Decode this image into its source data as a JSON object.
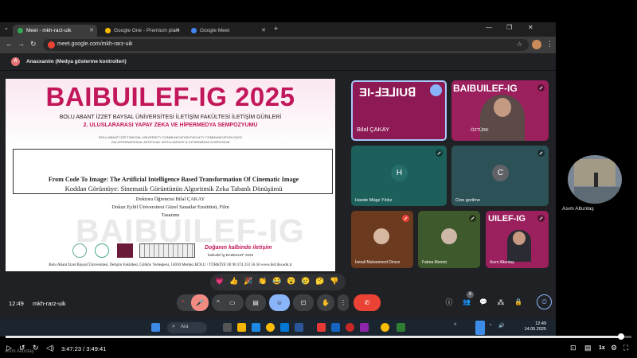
{
  "browser": {
    "tabs": [
      {
        "label": "Meet - mkh-rarz-uik",
        "active": true
      },
      {
        "label": "Google One - Premium planı",
        "active": false
      },
      {
        "label": "Google Meet",
        "active": false
      }
    ],
    "url": "meet.google.com/mkh-rarz-uik"
  },
  "infobar": {
    "avatar_letter": "A",
    "text": "Anasxanim (Medya gösterme kontrolleri)"
  },
  "slide": {
    "title": "BAIBUILEF-IG 2025",
    "subtitle1": "BOLU ABANT İZZET BAYSAL ÜNİVERSİTESİ İLETİŞİM FAKÜLTESİ İLETİŞİM GÜNLERİ",
    "subtitle2": "2. ULUSLARARASI YAPAY ZEKA VE HİPERMEDYA SEMPOZYUMU",
    "subtitle3": "BOLU ABANT İZZET BAYSAL UNIVERSITY COMMUNICATION FACULTY COMMUNICATION DAYS",
    "subtitle4": "2nd INTERNATIONAL ARTIFICIAL INTELLIGENCE & HYPERMEDIA SYMPOSIUM",
    "title_en": "From Code To Image: The Artificial  Intelligence Based Transformation Of Cinematic Image",
    "title_tr": "Koddan Görüntüye: Sinematik Görüntünün Algoritmik Zeka Tabanlı Dönüşümü",
    "author1": "Doktora Öğrencisi Bilal ÇAKAY",
    "author2": "Dokuz Eylül Üniversitesi Güzel Sanatlar Enstitüsü, Film",
    "author3": "Tasarımı",
    "watermark": "BAIBUILEF-IG",
    "motto": "Doğanın kalbinde iletişim",
    "handles": "baibuilef ig   BAIBUILEF 2025",
    "footer": "Bolu Abant İzzet Baysal Üniversitesi, İletişim Fakültesi, Gölköy Yerleşkesi, 14030 Merkez BOLU / TÜRKİYE  00 90 374 253 56 56  www.ilef.ibu.edu.tr"
  },
  "tiles": [
    {
      "name": "Bilal ÇAKAY",
      "big": "ƎI-ℲƎ⅃IUꓭ"
    },
    {
      "name": "ÖZTÜRK",
      "big": "BAIBUILEF-IG"
    },
    {
      "name": "Hande Müge Yıldız",
      "initial": "H"
    },
    {
      "name": "Cine gorilme",
      "initial": "C"
    },
    {
      "name": "İsmail Muhammed Dincer"
    },
    {
      "name": "Fatma Memici"
    },
    {
      "name": "Asım Altuntaş",
      "big": "UILEF-IG"
    }
  ],
  "reactions": [
    "💗",
    "👍",
    "🎉",
    "👏",
    "😂",
    "😮",
    "😢",
    "🤔",
    "👎"
  ],
  "meeting": {
    "time": "12:49",
    "code": "mkh-rarz-uik",
    "badge_people": "8"
  },
  "controls": {
    "chevron": "^",
    "mic": "🎤",
    "cam": "▭",
    "cc": "▤",
    "emoji": "☺",
    "present": "⊡",
    "hand": "✋",
    "more": "⋮",
    "hangup": "✆"
  },
  "right_controls": {
    "info": "ⓘ",
    "people": "👥",
    "chat": "💬",
    "activities": "⁂",
    "lock": "🔒",
    "timer": "⏲"
  },
  "taskbar": {
    "search": "Ara",
    "time": "12:49",
    "date": "14.05.2025"
  },
  "selfview": {
    "name": "Asım Altuntaş"
  },
  "player": {
    "time": "3:47:23 / 3:49:41",
    "progress": 0.983,
    "watermark": "Asım Altuntaş",
    "speed": "1x"
  },
  "colors": {
    "accent_pink": "#c2185b",
    "hangup_red": "#ea4335",
    "meet_blue": "#8ab4f8"
  }
}
